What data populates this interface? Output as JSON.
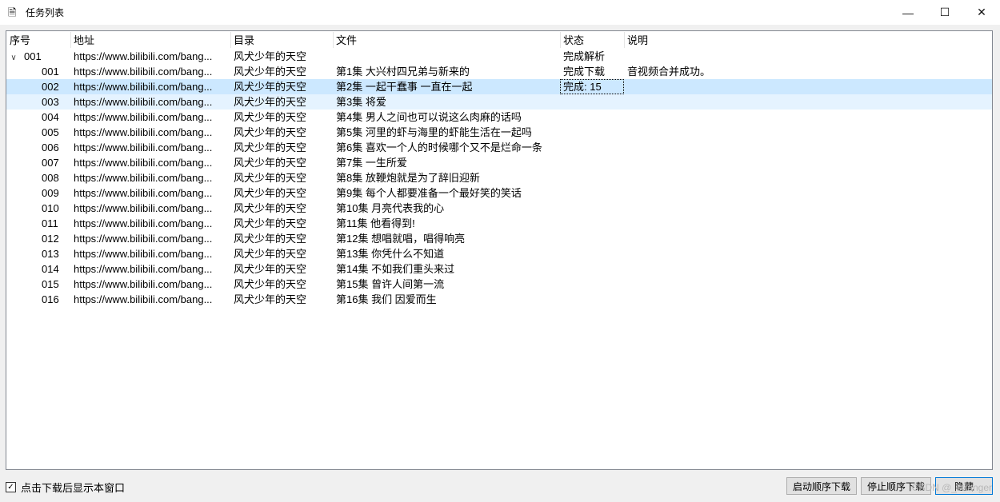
{
  "window": {
    "title": "任务列表",
    "app_icon": "document-icon",
    "min": "—",
    "max": "☐",
    "close": "✕"
  },
  "columns": {
    "id": "序号",
    "url": "地址",
    "dir": "目录",
    "file": "文件",
    "status": "状态",
    "desc": "说明"
  },
  "group": {
    "id": "001",
    "url": "https://www.bilibili.com/bang...",
    "dir": "风犬少年的天空",
    "file": "",
    "status": "完成解析",
    "desc": ""
  },
  "rows": [
    {
      "id": "001",
      "url": "https://www.bilibili.com/bang...",
      "dir": "风犬少年的天空",
      "file": "第1集 大兴村四兄弟与新来的",
      "status": "完成下载",
      "desc": "音视频合并成功。"
    },
    {
      "id": "002",
      "url": "https://www.bilibili.com/bang...",
      "dir": "风犬少年的天空",
      "file": "第2集 一起干蠢事 一直在一起",
      "status": "完成: 15",
      "desc": ""
    },
    {
      "id": "003",
      "url": "https://www.bilibili.com/bang...",
      "dir": "风犬少年的天空",
      "file": "第3集 将爱",
      "status": "",
      "desc": ""
    },
    {
      "id": "004",
      "url": "https://www.bilibili.com/bang...",
      "dir": "风犬少年的天空",
      "file": "第4集 男人之间也可以说这么肉麻的话吗",
      "status": "",
      "desc": ""
    },
    {
      "id": "005",
      "url": "https://www.bilibili.com/bang...",
      "dir": "风犬少年的天空",
      "file": "第5集 河里的虾与海里的虾能生活在一起吗",
      "status": "",
      "desc": ""
    },
    {
      "id": "006",
      "url": "https://www.bilibili.com/bang...",
      "dir": "风犬少年的天空",
      "file": "第6集 喜欢一个人的时候哪个又不是烂命一条",
      "status": "",
      "desc": ""
    },
    {
      "id": "007",
      "url": "https://www.bilibili.com/bang...",
      "dir": "风犬少年的天空",
      "file": "第7集 一生所爱",
      "status": "",
      "desc": ""
    },
    {
      "id": "008",
      "url": "https://www.bilibili.com/bang...",
      "dir": "风犬少年的天空",
      "file": "第8集 放鞭炮就是为了辞旧迎新",
      "status": "",
      "desc": ""
    },
    {
      "id": "009",
      "url": "https://www.bilibili.com/bang...",
      "dir": "风犬少年的天空",
      "file": "第9集 每个人都要准备一个最好笑的笑话",
      "status": "",
      "desc": ""
    },
    {
      "id": "010",
      "url": "https://www.bilibili.com/bang...",
      "dir": "风犬少年的天空",
      "file": "第10集 月亮代表我的心",
      "status": "",
      "desc": ""
    },
    {
      "id": "011",
      "url": "https://www.bilibili.com/bang...",
      "dir": "风犬少年的天空",
      "file": "第11集 他看得到!",
      "status": "",
      "desc": ""
    },
    {
      "id": "012",
      "url": "https://www.bilibili.com/bang...",
      "dir": "风犬少年的天空",
      "file": "第12集 想唱就唱，唱得响亮",
      "status": "",
      "desc": ""
    },
    {
      "id": "013",
      "url": "https://www.bilibili.com/bang...",
      "dir": "风犬少年的天空",
      "file": "第13集 你凭什么不知道",
      "status": "",
      "desc": ""
    },
    {
      "id": "014",
      "url": "https://www.bilibili.com/bang...",
      "dir": "风犬少年的天空",
      "file": "第14集 不如我们重头来过",
      "status": "",
      "desc": ""
    },
    {
      "id": "015",
      "url": "https://www.bilibili.com/bang...",
      "dir": "风犬少年的天空",
      "file": "第15集 曾许人间第一流",
      "status": "",
      "desc": ""
    },
    {
      "id": "016",
      "url": "https://www.bilibili.com/bang...",
      "dir": "风犬少年的天空",
      "file": "第16集 我们 因爱而生",
      "status": "",
      "desc": ""
    }
  ],
  "footer": {
    "checkbox_label": "点击下载后显示本窗口",
    "checkbox_mark": "✓",
    "start_button": "启动顺序下载",
    "stop_button": "停止顺序下载",
    "hide_button": "隐藏",
    "watermark": "CSDN @_stranger"
  },
  "colors": {
    "selected_row": "#cce8ff",
    "hover_row": "#e5f3ff",
    "default_button_border": "#0078d7"
  }
}
